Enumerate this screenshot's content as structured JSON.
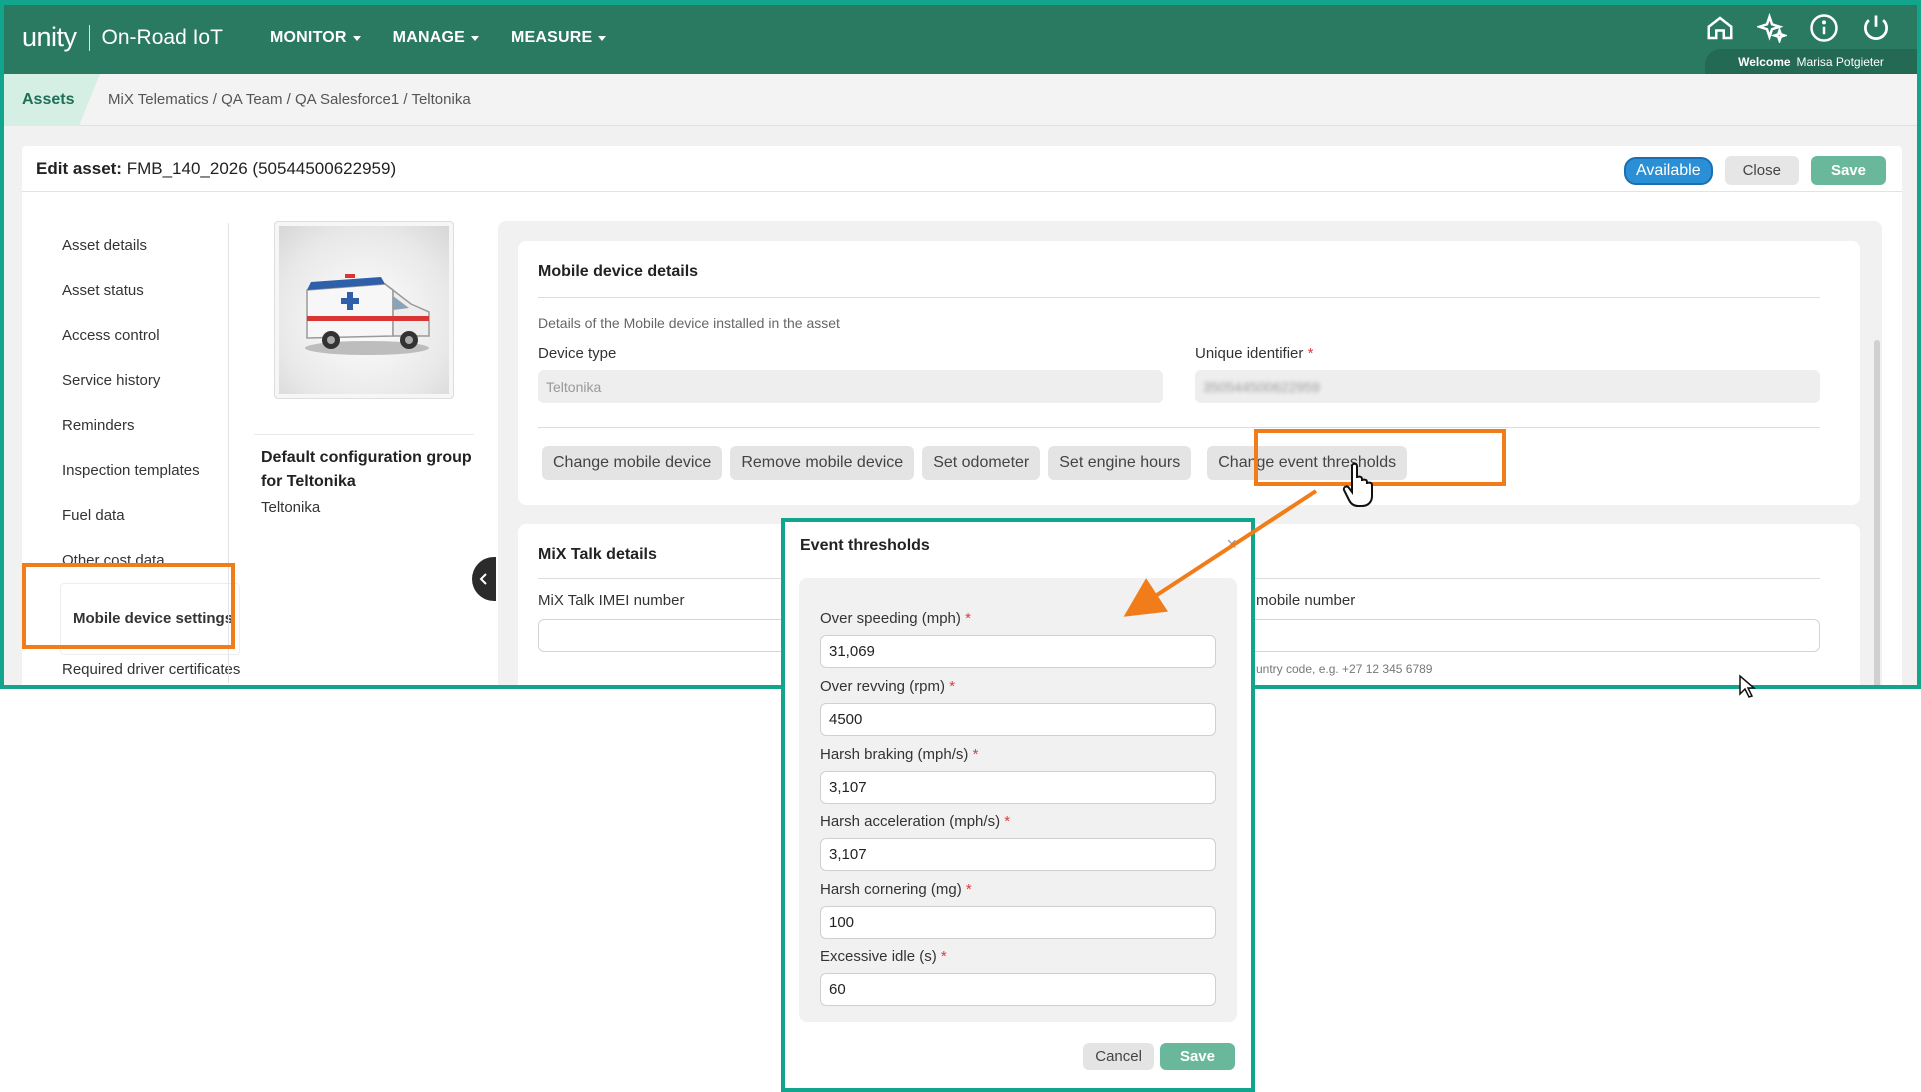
{
  "app": {
    "logo": "unity",
    "product": "On-Road IoT",
    "nav": [
      {
        "label": "MONITOR"
      },
      {
        "label": "MANAGE"
      },
      {
        "label": "MEASURE"
      }
    ],
    "icons": [
      "home-icon",
      "sparkle-icon",
      "info-icon",
      "power-icon"
    ],
    "welcome_label": "Welcome",
    "user_name": "Marisa Potgieter"
  },
  "breadcrumb": {
    "tab": "Assets",
    "path": "MiX Telematics / QA Team / QA Salesforce1 / Teltonika"
  },
  "edit": {
    "label": "Edit asset:",
    "asset": "FMB_140_2026 (50544500622959)",
    "status": "Available",
    "close": "Close",
    "save": "Save"
  },
  "sidebar": {
    "items": [
      {
        "label": "Asset details"
      },
      {
        "label": "Asset status"
      },
      {
        "label": "Access control"
      },
      {
        "label": "Service history"
      },
      {
        "label": "Reminders"
      },
      {
        "label": "Inspection templates"
      },
      {
        "label": "Fuel data"
      },
      {
        "label": "Other cost data"
      },
      {
        "label": "Mobile device settings"
      },
      {
        "label": "Required driver certificates"
      }
    ]
  },
  "config": {
    "title": "Default configuration group for Teltonika",
    "subtitle": "Teltonika"
  },
  "mobile_panel": {
    "title": "Mobile device details",
    "description": "Details of the Mobile device installed in the asset",
    "device_type_label": "Device type",
    "device_type_value": "Teltonika",
    "uid_label": "Unique identifier",
    "uid_required": "*",
    "uid_value": "350544500622959",
    "actions": [
      {
        "label": "Change mobile device"
      },
      {
        "label": "Remove mobile device"
      },
      {
        "label": "Set odometer"
      },
      {
        "label": "Set engine hours"
      },
      {
        "label": "Change event thresholds"
      }
    ]
  },
  "mixtalk_panel": {
    "title": "MiX Talk details",
    "imei_label": "MiX Talk IMEI number",
    "mobile_label": "mobile number",
    "mobile_hint": "untry code, e.g. +27 12 345 6789"
  },
  "modal": {
    "title": "Event thresholds",
    "close": "×",
    "fields": [
      {
        "label": "Over speeding (mph)",
        "required": "*",
        "value": "31,069"
      },
      {
        "label": "Over revving (rpm)",
        "required": "*",
        "value": "4500"
      },
      {
        "label": "Harsh braking (mph/s)",
        "required": "*",
        "value": "3,107"
      },
      {
        "label": "Harsh acceleration (mph/s)",
        "required": "*",
        "value": "3,107"
      },
      {
        "label": "Harsh cornering (mg)",
        "required": "*",
        "value": "100"
      },
      {
        "label": "Excessive idle (s)",
        "required": "*",
        "value": "60"
      }
    ],
    "cancel": "Cancel",
    "save": "Save"
  },
  "colors": {
    "header_green": "#2a7a62",
    "frame_teal": "#10a58c",
    "highlight_orange": "#f07d1a",
    "save_green": "#6ab89b",
    "available_blue": "#2b8fd6"
  }
}
